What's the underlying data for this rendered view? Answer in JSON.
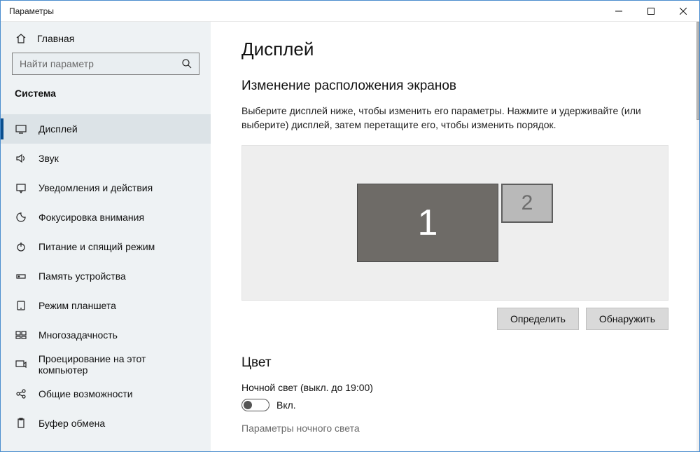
{
  "window": {
    "title": "Параметры"
  },
  "sidebar": {
    "home": "Главная",
    "search_placeholder": "Найти параметр",
    "section": "Система",
    "items": [
      {
        "id": "display",
        "label": "Дисплей"
      },
      {
        "id": "sound",
        "label": "Звук"
      },
      {
        "id": "notify",
        "label": "Уведомления и действия"
      },
      {
        "id": "focus",
        "label": "Фокусировка внимания"
      },
      {
        "id": "power",
        "label": "Питание и спящий режим"
      },
      {
        "id": "storage",
        "label": "Память устройства"
      },
      {
        "id": "tablet",
        "label": "Режим планшета"
      },
      {
        "id": "multitask",
        "label": "Многозадачность"
      },
      {
        "id": "projecting",
        "label": "Проецирование на этот компьютер"
      },
      {
        "id": "shared",
        "label": "Общие возможности"
      },
      {
        "id": "clipboard",
        "label": "Буфер обмена"
      }
    ]
  },
  "main": {
    "title": "Дисплей",
    "arrange_heading": "Изменение расположения экранов",
    "arrange_desc": "Выберите дисплей ниже, чтобы изменить его параметры. Нажмите и удерживайте (или выберите) дисплей, затем перетащите его, чтобы изменить порядок.",
    "monitors": {
      "m1": "1",
      "m2": "2"
    },
    "buttons": {
      "identify": "Определить",
      "detect": "Обнаружить"
    },
    "color_heading": "Цвет",
    "night_light_label": "Ночной свет (выкл. до 19:00)",
    "toggle_on_label": "Вкл.",
    "night_light_settings": "Параметры ночного света"
  }
}
